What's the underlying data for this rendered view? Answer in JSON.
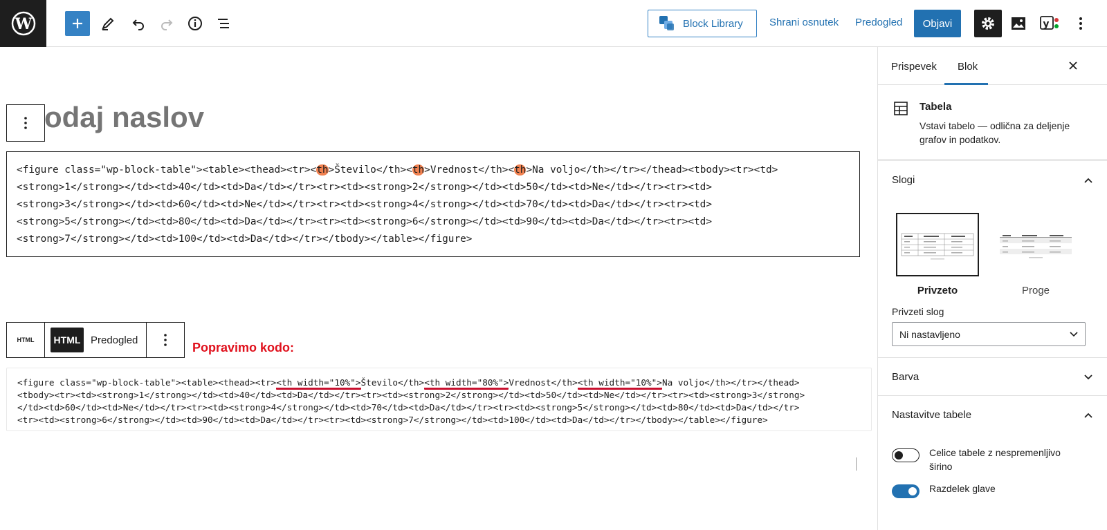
{
  "toolbar": {
    "block_library_label": "Block Library",
    "save_draft_label": "Shrani osnutek",
    "preview_label": "Predogled",
    "publish_label": "Objavi",
    "icons": [
      "wordpress-icon",
      "plus-icon",
      "pencil-icon",
      "undo-icon",
      "redo-icon",
      "info-icon",
      "list-view-icon",
      "block-library-icon",
      "gear-icon",
      "image-icon",
      "yoast-icon",
      "more-vertical-icon"
    ]
  },
  "editor": {
    "title_placeholder": "odaj naslov",
    "code1": {
      "lines": [
        [
          {
            "t": "<figure class=\"wp-block-table\"><table><thead><tr><"
          },
          {
            "t": "th",
            "hl": true
          },
          {
            "t": ">Število</th><"
          },
          {
            "t": "th",
            "hl": true
          },
          {
            "t": ">Vrednost</th><"
          },
          {
            "t": "th",
            "hl": true
          },
          {
            "t": ">Na voljo</th></tr></thead><tbody><tr><td>"
          }
        ],
        [
          {
            "t": "<strong>1</strong></td><td>40</td><td>Da</td></tr><tr><td><strong>2</strong></td><td>50</td><td>Ne</td></tr><tr><td>"
          }
        ],
        [
          {
            "t": "<strong>3</strong></td><td>60</td><td>Ne</td></tr><tr><td><strong>4</strong></td><td>70</td><td>Da</td></tr><tr><td>"
          }
        ],
        [
          {
            "t": "<strong>5</strong></td><td>80</td><td>Da</td></tr><tr><td><strong>6</strong></td><td>90</td><td>Da</td></tr><tr><td>"
          }
        ],
        [
          {
            "t": "<strong>7</strong></td><td>100</td><td>Da</td></tr></tbody></table></figure>"
          }
        ]
      ]
    },
    "html_toolbar": {
      "small_icon_label": "HTML",
      "html_button_label": "HTML",
      "preview_label": "Predogled"
    },
    "fix_label": "Popravimo kodo:",
    "code2": {
      "lines": [
        [
          {
            "t": "<figure class=\"wp-block-table\"><table><thead><tr>"
          },
          {
            "t": "<th width=\"10%\">",
            "ul": true
          },
          {
            "t": "Število</th>"
          },
          {
            "t": "<th width=\"80%\">",
            "ul": true
          },
          {
            "t": "Vrednost</th>"
          },
          {
            "t": "<th width=\"10%\">",
            "ul": true
          },
          {
            "t": "Na voljo</th></tr></thead>"
          }
        ],
        [
          {
            "t": "<tbody><tr><td><strong>1</strong></td><td>40</td><td>Da</td></tr><tr><td><strong>2</strong></td><td>50</td><td>Ne</td></tr><tr><td><strong>3</strong>"
          }
        ],
        [
          {
            "t": "</td><td>60</td><td>Ne</td></tr><tr><td><strong>4</strong></td><td>70</td><td>Da</td></tr><tr><td><strong>5</strong></td><td>80</td><td>Da</td></tr>"
          }
        ],
        [
          {
            "t": "<tr><td><strong>6</strong></td><td>90</td><td>Da</td></tr><tr><td><strong>7</strong></td><td>100</td><td>Da</td></tr></tbody></table></figure>"
          }
        ]
      ]
    }
  },
  "sidebar": {
    "tabs": [
      "Prispevek",
      "Blok"
    ],
    "active_tab": "Blok",
    "block_name": "Tabela",
    "block_description": "Vstavi tabelo — odlična za deljenje grafov in podatkov.",
    "panels": {
      "styles": "Slogi",
      "color": "Barva",
      "table_settings": "Nastavitve tabele"
    },
    "styles": [
      {
        "label": "Privzeto",
        "selected": true
      },
      {
        "label": "Proge",
        "selected": false
      }
    ],
    "default_style_label": "Privzeti slog",
    "default_style_value": "Ni nastavljeno",
    "toggles": [
      {
        "label": "Celice tabele z nespremenljivo širino",
        "on": false
      },
      {
        "label": "Razdelek glave",
        "on": true
      }
    ]
  },
  "colors": {
    "accent": "#2271b1",
    "dark": "#1e1e1e",
    "highlight": "#f08150",
    "annotation_red": "#e0101c"
  }
}
